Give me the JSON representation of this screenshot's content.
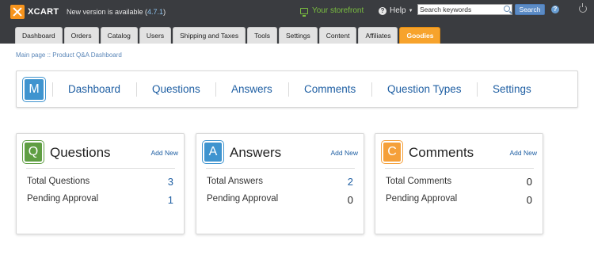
{
  "header": {
    "logo_text": "XCART",
    "new_version_prefix": "New version is available (",
    "new_version_number": "4.7.1",
    "new_version_suffix": ")",
    "storefront_label": "Your storefront",
    "help_label": "Help",
    "search_placeholder": "Search keywords",
    "search_button": "Search"
  },
  "tabs": [
    "Dashboard",
    "Orders",
    "Catalog",
    "Users",
    "Shipping and Taxes",
    "Tools",
    "Settings",
    "Content",
    "Affiliates",
    "Goodies"
  ],
  "breadcrumb": "Main page :: Product Q&A Dashboard",
  "nav": {
    "badge": "M",
    "items": [
      "Dashboard",
      "Questions",
      "Answers",
      "Comments",
      "Question Types",
      "Settings"
    ]
  },
  "cards": [
    {
      "badge": "Q",
      "title": "Questions",
      "add_new": "Add New",
      "rows": [
        {
          "label": "Total Questions",
          "value": "3"
        },
        {
          "label": "Pending Approval",
          "value": "1"
        }
      ]
    },
    {
      "badge": "A",
      "title": "Answers",
      "add_new": "Add New",
      "rows": [
        {
          "label": "Total Answers",
          "value": "2"
        },
        {
          "label": "Pending Approval",
          "value": "0"
        }
      ]
    },
    {
      "badge": "C",
      "title": "Comments",
      "add_new": "Add New",
      "rows": [
        {
          "label": "Total Comments",
          "value": "0"
        },
        {
          "label": "Pending Approval",
          "value": "0"
        }
      ]
    }
  ],
  "colors": {
    "topbar": "#3a3c40",
    "accent": "#f7a32c",
    "link": "#1f5fa3",
    "badge_m": "#3f94cf",
    "badge_q": "#5f9e43",
    "badge_a": "#3f94cf",
    "badge_c": "#f5a03a"
  },
  "icons": {
    "logo": "xcart-logo-icon",
    "storefront": "monitor-icon",
    "help": "question-circle-icon",
    "search": "search-icon",
    "info": "help-icon",
    "logout": "power-icon"
  }
}
